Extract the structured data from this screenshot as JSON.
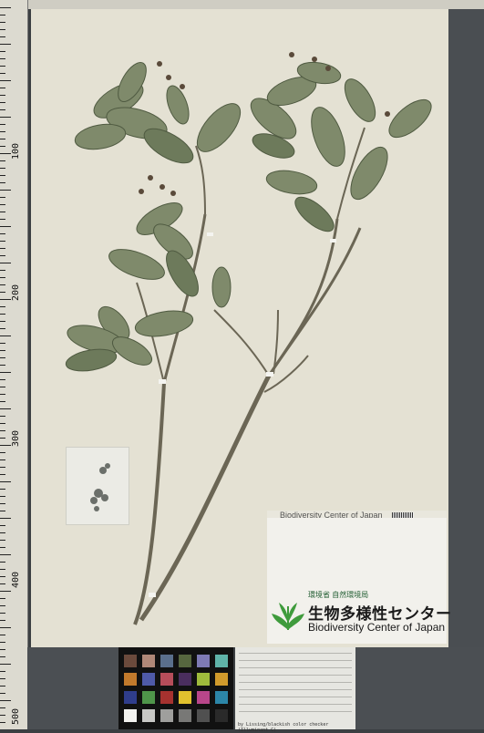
{
  "ruler": {
    "labels": [
      "100",
      "200",
      "300",
      "400",
      "500"
    ]
  },
  "label": {
    "strip_text": "Biodiversity Center of Japan",
    "org_small": "環境省 自然環境局",
    "org_jp": "生物多様性センター",
    "org_en": "Biodiversity Center of Japan"
  },
  "colorcard_caption": "by Lissing/blackish color checker (Illuminant C)",
  "colors": {
    "sheet": "#e4e1d3",
    "leaf": "#7f8a6b",
    "leaf_dark": "#5e6a4e",
    "stem": "#6b6655",
    "logo_green": "#3f9b3c"
  }
}
